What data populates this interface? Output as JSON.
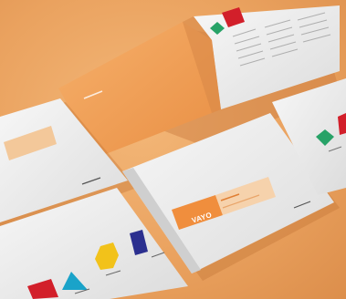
{
  "image": {
    "subject": "brochure-mockups",
    "colors": {
      "background": "#eaa25f",
      "paper": "#efefef",
      "cover_orange": "#f0a05a",
      "accent_red": "#d21f2a",
      "accent_green": "#27a267",
      "accent_teal": "#1aa3c9",
      "accent_yellow": "#f2c21a",
      "accent_navy": "#2b2f8f"
    }
  },
  "brochure_center": {
    "brand_text": "VAYO"
  }
}
